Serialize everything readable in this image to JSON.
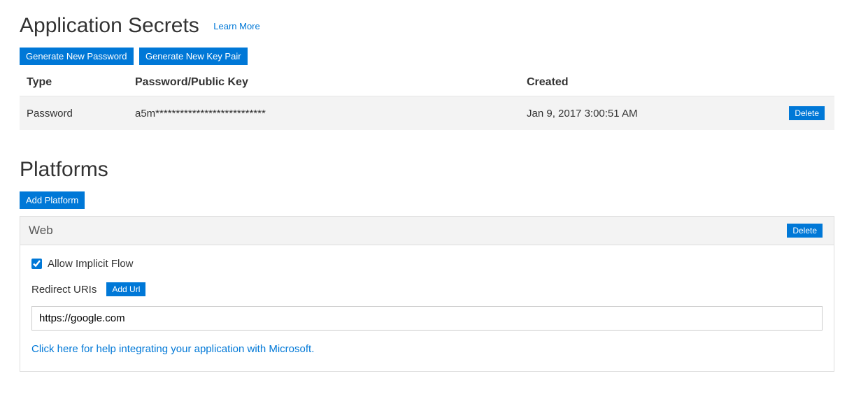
{
  "secrets": {
    "title": "Application Secrets",
    "learn_more": "Learn More",
    "generate_password_label": "Generate New Password",
    "generate_keypair_label": "Generate New Key Pair",
    "columns": {
      "type": "Type",
      "key": "Password/Public Key",
      "created": "Created"
    },
    "rows": [
      {
        "type": "Password",
        "key": "a5m***************************",
        "created": "Jan 9, 2017 3:00:51 AM",
        "delete_label": "Delete"
      }
    ]
  },
  "platforms": {
    "title": "Platforms",
    "add_platform_label": "Add Platform",
    "items": [
      {
        "name": "Web",
        "delete_label": "Delete",
        "allow_implicit_flow_label": "Allow Implicit Flow",
        "allow_implicit_flow_checked": true,
        "redirect_uris_label": "Redirect URIs",
        "add_url_label": "Add Url",
        "uris": [
          "https://google.com"
        ],
        "help_text": "Click here for help integrating your application with Microsoft."
      }
    ]
  }
}
